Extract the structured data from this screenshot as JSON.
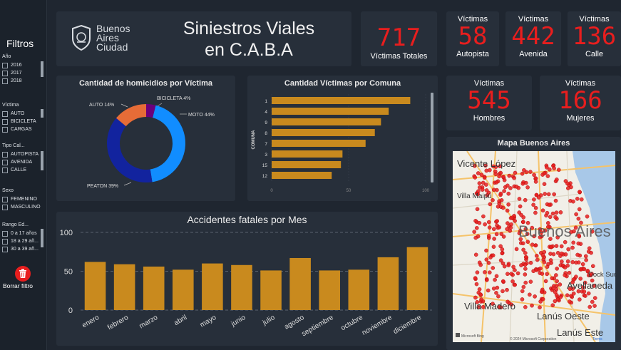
{
  "sidebar": {
    "title": "Filtros",
    "groups": [
      {
        "head": "Año",
        "items": [
          "2016",
          "2017",
          "2018"
        ]
      },
      {
        "head": "Víctima",
        "items": [
          "AUTO",
          "BICICLETA",
          "CARGAS"
        ]
      },
      {
        "head": "Tipo Cal...",
        "items": [
          "AUTOPISTA",
          "AVENIDA",
          "CALLE"
        ]
      },
      {
        "head": "Sexo",
        "items": [
          "FEMENINO",
          "MASCULINO"
        ]
      },
      {
        "head": "Rango Ed...",
        "items": [
          "0 a 17 años",
          "18 a 29 añ...",
          "30 a 39 añ..."
        ]
      }
    ],
    "reset_label": "Borrar filtro"
  },
  "header": {
    "logo_line1": "Buenos",
    "logo_line2": "Aires",
    "logo_line3": "Ciudad",
    "title_line1": "Siniestros Viales",
    "title_line2": "en C.A.B.A"
  },
  "kpis": {
    "total": {
      "value": "717",
      "label": "Víctimas Totales"
    },
    "autopista": {
      "top": "Víctimas",
      "value": "58",
      "label": "Autopista"
    },
    "avenida": {
      "top": "Víctimas",
      "value": "442",
      "label": "Avenida"
    },
    "calle": {
      "top": "Víctimas",
      "value": "136",
      "label": "Calle"
    },
    "hombres": {
      "top": "Víctimas",
      "value": "545",
      "label": "Hombres"
    },
    "mujeres": {
      "top": "Víctimas",
      "value": "166",
      "label": "Mujeres"
    }
  },
  "chart_data": [
    {
      "type": "pie",
      "title": "Cantidad de homicidios por Víctima",
      "slices": [
        {
          "label": "MOTO",
          "value": 44,
          "text": "MOTO 44%",
          "color": "#118dff"
        },
        {
          "label": "PEATON",
          "value": 39,
          "text": "PEATON 39%",
          "color": "#12239e"
        },
        {
          "label": "AUTO",
          "value": 14,
          "text": "AUTO 14%",
          "color": "#e66c37"
        },
        {
          "label": "BICICLETA",
          "value": 4,
          "text": "BICICLETA 4%",
          "color": "#6b007b"
        }
      ]
    },
    {
      "type": "bar",
      "orientation": "horizontal",
      "title": "Cantidad Víctimas por Comuna",
      "ylabel": "COMUNA",
      "categories": [
        "1",
        "4",
        "9",
        "8",
        "7",
        "3",
        "15",
        "12"
      ],
      "values": [
        90,
        76,
        71,
        67,
        61,
        46,
        45,
        39
      ],
      "xlim": [
        0,
        100
      ],
      "xticks": [
        "0",
        "50",
        "100"
      ],
      "color": "#c98a1e"
    },
    {
      "type": "bar",
      "title": "Accidentes fatales por Mes",
      "categories": [
        "enero",
        "febrero",
        "marzo",
        "abril",
        "mayo",
        "junio",
        "julio",
        "agosto",
        "septiembre",
        "octubre",
        "noviembre",
        "diciembre"
      ],
      "values": [
        62,
        59,
        56,
        52,
        60,
        58,
        51,
        67,
        51,
        52,
        68,
        81
      ],
      "ylim": [
        0,
        100
      ],
      "yticks": [
        "0",
        "50",
        "100"
      ],
      "grid": true,
      "color": "#c98a1e"
    }
  ],
  "map": {
    "title": "Mapa Buenos Aires",
    "labels": [
      "Vicente López",
      "Villa Maipú",
      "Buenos Aires",
      "Dock Sud",
      "Avellaneda",
      "Villa Madero",
      "Lanús Oeste",
      "Lanús Este"
    ],
    "attribution": "© 2024 Microsoft Corporation",
    "terms": "Terms",
    "brand": "Microsoft Bing",
    "colors": {
      "land": "#f1efe8",
      "water": "#a8c8e8",
      "dot": "#e81e1e",
      "road": "#f5c36a"
    }
  }
}
